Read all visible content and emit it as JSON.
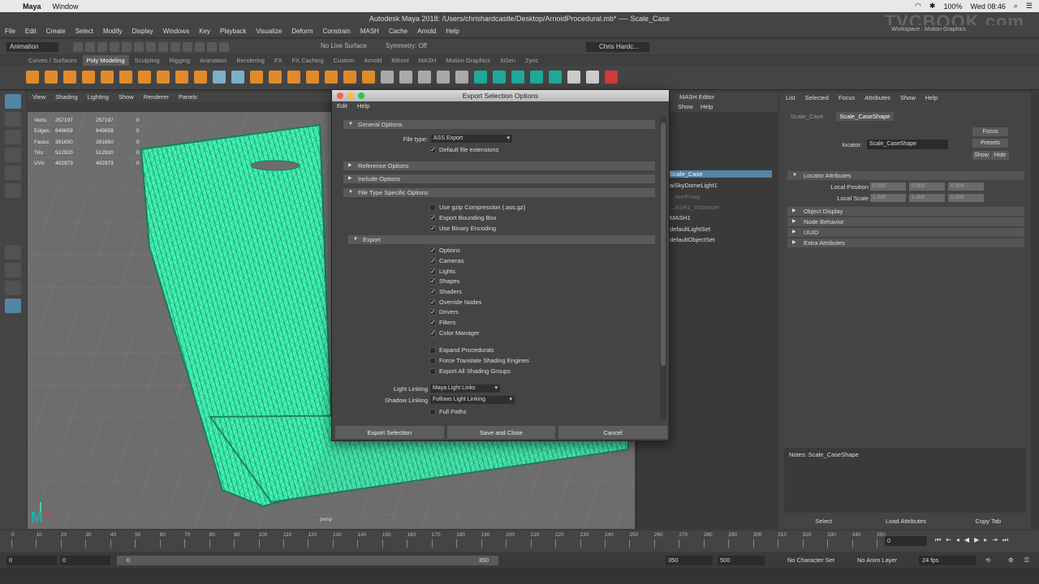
{
  "mac_menu": {
    "app": "Maya",
    "items": [
      "Window"
    ],
    "battery": "100%",
    "clock": "Wed 08:46"
  },
  "title": "Autodesk Maya 2018: /Users/chrishardcastle/Desktop/ArnoidProcedural.mb*  ----  Scale_Case",
  "watermark": "TVCBOOK.com",
  "maya_menu": [
    "File",
    "Edit",
    "Create",
    "Select",
    "Modify",
    "Display",
    "Windows",
    "Key",
    "Playback",
    "Visualize",
    "Deform",
    "Constrain",
    "MASH",
    "Cache",
    "Arnold",
    "Help"
  ],
  "workspace": {
    "label": "Workspace :",
    "value": "Motion Graphics"
  },
  "status_line": {
    "mode": "Animation",
    "live_surface": "No Live Surface",
    "symmetry": "Symmetry: Off",
    "user": "Chris Hardc..."
  },
  "shelf_tabs": [
    "Curves / Surfaces",
    "Poly Modeling",
    "Sculpting",
    "Rigging",
    "Animation",
    "Rendering",
    "FX",
    "FX Caching",
    "Custom",
    "Arnold",
    "Bifrost",
    "MASH",
    "Motion Graphics",
    "XGen",
    "Zync"
  ],
  "shelf_active": "Poly Modeling",
  "viewport": {
    "menu": [
      "View",
      "Shading",
      "Lighting",
      "Show",
      "Renderer",
      "Panels"
    ],
    "hud": [
      {
        "label": "Verts:",
        "a": "257197",
        "b": "257197",
        "c": "0"
      },
      {
        "label": "Edges:",
        "a": "649659",
        "b": "649659",
        "c": "0"
      },
      {
        "label": "Faces:",
        "a": "391650",
        "b": "391650",
        "c": "0"
      },
      {
        "label": "Tris:",
        "a": "512920",
        "b": "512920",
        "c": "0"
      },
      {
        "label": "UVs:",
        "a": "402973",
        "b": "402973",
        "c": "0"
      }
    ],
    "camera": "persp"
  },
  "dialog": {
    "title": "Export Selection Options",
    "menu": [
      "Edit",
      "Help"
    ],
    "sections": {
      "general": "General Options",
      "reference": "Reference Options",
      "include": "Include Options",
      "filetype": "File Type Specific Options",
      "export": "Export"
    },
    "file_type_label": "File type:",
    "file_type_value": "ASS Export",
    "default_ext": "Default file extensions",
    "gzip": "Use gzip Compression (.ass.gz)",
    "bbox": "Export Bounding Box",
    "binary": "Use Binary Encoding",
    "export_items": [
      "Options",
      "Cameras",
      "Lights",
      "Shapes",
      "Shaders",
      "Override Nodes",
      "Drivers",
      "Filters",
      "Color Manager"
    ],
    "extra_items": [
      "Expand Procedurals",
      "Force Translate Shading Engines",
      "Export All Shading Groups"
    ],
    "light_linking_label": "Light Linking",
    "light_linking_value": "Maya Light Links",
    "shadow_linking_label": "Shadow Linking",
    "shadow_linking_value": "Follows Light Linking",
    "full_paths": "Full Paths",
    "buttons": {
      "export": "Export Selection",
      "save": "Save and Close",
      "cancel": "Cancel"
    }
  },
  "outliner": {
    "panel": "MASH Editor",
    "menu": [
      "Show",
      "Help"
    ],
    "items": [
      {
        "label": "...",
        "dim": true
      },
      {
        "label": "...",
        "dim": true
      },
      {
        "label": "...",
        "dim": true
      },
      {
        "label": "...",
        "dim": true
      },
      {
        "label": "Scale_Case",
        "dim": false,
        "selected": true
      },
      {
        "label": "aiSkyDomeLight1",
        "dim": false
      },
      {
        "label": "...aceProxy",
        "dim": true
      },
      {
        "label": "...ASH1_Instancer",
        "dim": true
      },
      {
        "label": "MASH1",
        "dim": false
      },
      {
        "label": "defaultLightSet",
        "dim": false
      },
      {
        "label": "defaultObjectSet",
        "dim": false
      }
    ]
  },
  "attribute_editor": {
    "menu": [
      "List",
      "Selected",
      "Focus",
      "Attributes",
      "Show",
      "Help"
    ],
    "tabs": [
      "Scale_Case",
      "Scale_CaseShape"
    ],
    "active_tab": "Scale_CaseShape",
    "focus": "Focus",
    "presets": "Presets",
    "show": "Show",
    "hide": "Hide",
    "locator_label": "locator:",
    "locator_value": "Scale_CaseShape",
    "sections": [
      "Locator Attributes",
      "Object Display",
      "Node Behavior",
      "UUID",
      "Extra Attributes"
    ],
    "local_position": "Local Position",
    "local_scale": "Local Scale",
    "position_values": [
      "0.000",
      "0.000",
      "0.000"
    ],
    "scale_values": [
      "1.000",
      "1.000",
      "1.000"
    ],
    "notes": "Notes:  Scale_CaseShape",
    "buttons": [
      "Select",
      "Load Attributes",
      "Copy Tab"
    ]
  },
  "time_slider": {
    "ticks": [
      "0",
      "10",
      "20",
      "30",
      "40",
      "50",
      "60",
      "70",
      "80",
      "90",
      "100",
      "110",
      "120",
      "130",
      "140",
      "150",
      "160",
      "170",
      "180",
      "190",
      "200",
      "210",
      "220",
      "230",
      "240",
      "250",
      "260",
      "270",
      "280",
      "290",
      "300",
      "310",
      "320",
      "330",
      "340",
      "350"
    ],
    "current_frame": "0"
  },
  "range_slider": {
    "start": "0",
    "anim_start": "0",
    "range_start": "0",
    "range_end": "350",
    "anim_end": "350",
    "end": "500",
    "character": "No Character Set",
    "anim_layer": "No Anim Layer",
    "fps": "24 fps"
  },
  "colors": {
    "accent": "#5285a6",
    "mesh": "#3df5b4"
  }
}
